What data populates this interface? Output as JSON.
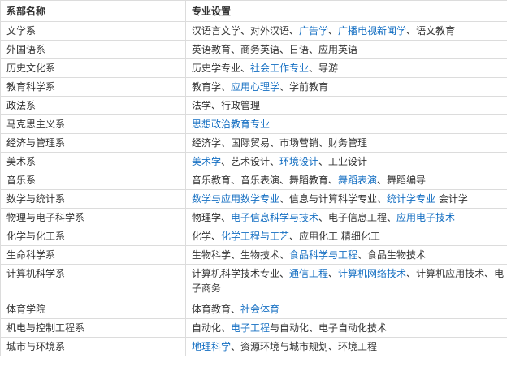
{
  "table": {
    "headers": [
      "系部名称",
      "专业设置"
    ],
    "link_color": "#136ec2",
    "text_color": "#333333",
    "rows": [
      {
        "department": "文学系",
        "majors": [
          {
            "t": "汉语言文学、对外汉语、"
          },
          {
            "t": "广告学",
            "link": true
          },
          {
            "t": "、"
          },
          {
            "t": "广播电视新闻学",
            "link": true
          },
          {
            "t": "、语文教育"
          }
        ]
      },
      {
        "department": "外国语系",
        "majors": [
          {
            "t": "英语教育、商务英语、日语、应用英语"
          }
        ]
      },
      {
        "department": "历史文化系",
        "majors": [
          {
            "t": "历史学专业、"
          },
          {
            "t": "社会工作专业",
            "link": true
          },
          {
            "t": "、导游"
          }
        ]
      },
      {
        "department": "教育科学系",
        "majors": [
          {
            "t": "教育学、"
          },
          {
            "t": "应用心理学",
            "link": true
          },
          {
            "t": "、学前教育"
          }
        ]
      },
      {
        "department": "政法系",
        "majors": [
          {
            "t": "法学、行政管理"
          }
        ]
      },
      {
        "department": "马克思主义系",
        "majors": [
          {
            "t": "思想政治教育专业",
            "link": true
          }
        ]
      },
      {
        "department": "经济与管理系",
        "majors": [
          {
            "t": "经济学、国际贸易、市场营销、财务管理"
          }
        ]
      },
      {
        "department": "美术系",
        "majors": [
          {
            "t": "美术学",
            "link": true
          },
          {
            "t": "、艺术设计、"
          },
          {
            "t": "环境设计",
            "link": true
          },
          {
            "t": "、工业设计"
          }
        ]
      },
      {
        "department": "音乐系",
        "majors": [
          {
            "t": "音乐教育、音乐表演、舞蹈教育、"
          },
          {
            "t": "舞蹈表演",
            "link": true
          },
          {
            "t": "、舞蹈编导"
          }
        ]
      },
      {
        "department": "数学与统计系",
        "majors": [
          {
            "t": "数学与应用数学专业",
            "link": true
          },
          {
            "t": "、信息与计算科学专业、"
          },
          {
            "t": "统计学专业",
            "link": true
          },
          {
            "t": " 会计学"
          }
        ]
      },
      {
        "department": "物理与电子科学系",
        "majors": [
          {
            "t": "物理学、"
          },
          {
            "t": "电子信息科学与技术",
            "link": true
          },
          {
            "t": "、电子信息工程、"
          },
          {
            "t": "应用电子技术",
            "link": true
          }
        ]
      },
      {
        "department": "化学与化工系",
        "majors": [
          {
            "t": "化学、"
          },
          {
            "t": "化学工程与工艺",
            "link": true
          },
          {
            "t": "、应用化工 精细化工"
          }
        ]
      },
      {
        "department": "生命科学系",
        "majors": [
          {
            "t": "生物科学、生物技术、"
          },
          {
            "t": "食品科学与工程",
            "link": true
          },
          {
            "t": "、食品生物技术"
          }
        ]
      },
      {
        "department": "计算机科学系",
        "tall": true,
        "majors": [
          {
            "t": "计算机科学技术专业、"
          },
          {
            "t": "通信工程",
            "link": true
          },
          {
            "t": "、"
          },
          {
            "t": "计算机网络技术",
            "link": true
          },
          {
            "t": "、计算机应用技术、电子商务"
          }
        ]
      },
      {
        "department": "体育学院",
        "majors": [
          {
            "t": "体育教育、"
          },
          {
            "t": "社会体育",
            "link": true
          }
        ]
      },
      {
        "department": "机电与控制工程系",
        "majors": [
          {
            "t": "自动化、"
          },
          {
            "t": "电子工程",
            "link": true
          },
          {
            "t": "与自动化、电子自动化技术"
          }
        ]
      },
      {
        "department": "城市与环境系",
        "majors": [
          {
            "t": "地理科学",
            "link": true
          },
          {
            "t": "、资源环境与城市规划、环境工程"
          }
        ]
      }
    ]
  }
}
